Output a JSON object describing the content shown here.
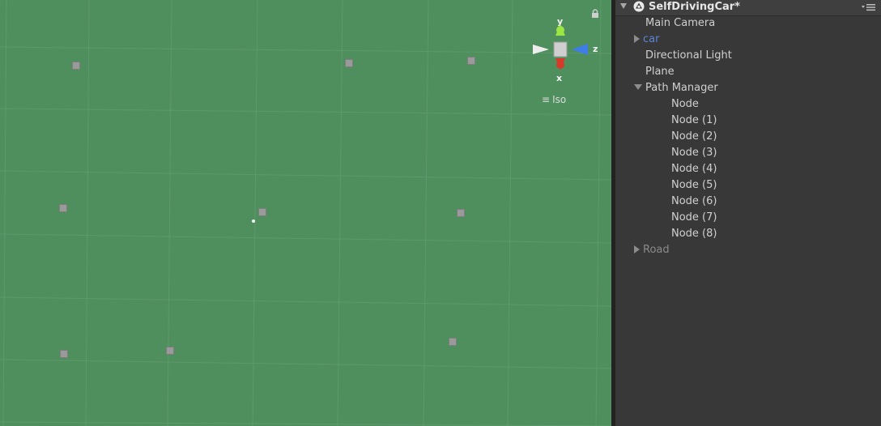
{
  "scene_view": {
    "gizmo": {
      "y_label": "y",
      "z_label": "z",
      "x_label": "x"
    },
    "projection_mode": "Iso",
    "icons": {
      "lock": "lock-icon",
      "projection_menu": "menu-lines-icon"
    },
    "colors": {
      "background": "#4f8f5e",
      "gizmo_y": "#9be642",
      "gizmo_z": "#3f7de8",
      "gizmo_x": "#d53a2a"
    }
  },
  "hierarchy": {
    "scene_name": "SelfDrivingCar*",
    "icons": {
      "scene": "unity-logo-icon",
      "menu": "options-menu-icon"
    },
    "items": [
      {
        "label": "Main Camera",
        "indent": 0,
        "foldout": "none",
        "style": "normal"
      },
      {
        "label": "car",
        "indent": 0,
        "foldout": "collapsed",
        "style": "prefab"
      },
      {
        "label": "Directional Light",
        "indent": 0,
        "foldout": "none",
        "style": "normal"
      },
      {
        "label": "Plane",
        "indent": 0,
        "foldout": "none",
        "style": "normal"
      },
      {
        "label": "Path Manager",
        "indent": 0,
        "foldout": "expanded",
        "style": "normal"
      },
      {
        "label": "Node",
        "indent": 1,
        "foldout": "none",
        "style": "normal"
      },
      {
        "label": "Node (1)",
        "indent": 1,
        "foldout": "none",
        "style": "normal"
      },
      {
        "label": "Node (2)",
        "indent": 1,
        "foldout": "none",
        "style": "normal"
      },
      {
        "label": "Node (3)",
        "indent": 1,
        "foldout": "none",
        "style": "normal"
      },
      {
        "label": "Node (4)",
        "indent": 1,
        "foldout": "none",
        "style": "normal"
      },
      {
        "label": "Node (5)",
        "indent": 1,
        "foldout": "none",
        "style": "normal"
      },
      {
        "label": "Node (6)",
        "indent": 1,
        "foldout": "none",
        "style": "normal"
      },
      {
        "label": "Node (7)",
        "indent": 1,
        "foldout": "none",
        "style": "normal"
      },
      {
        "label": "Node (8)",
        "indent": 1,
        "foldout": "none",
        "style": "normal"
      },
      {
        "label": "Road",
        "indent": 0,
        "foldout": "collapsed",
        "style": "inactive"
      }
    ],
    "colors": {
      "prefab_text": "#5b84d8",
      "inactive_text": "#8a8a8a"
    }
  }
}
